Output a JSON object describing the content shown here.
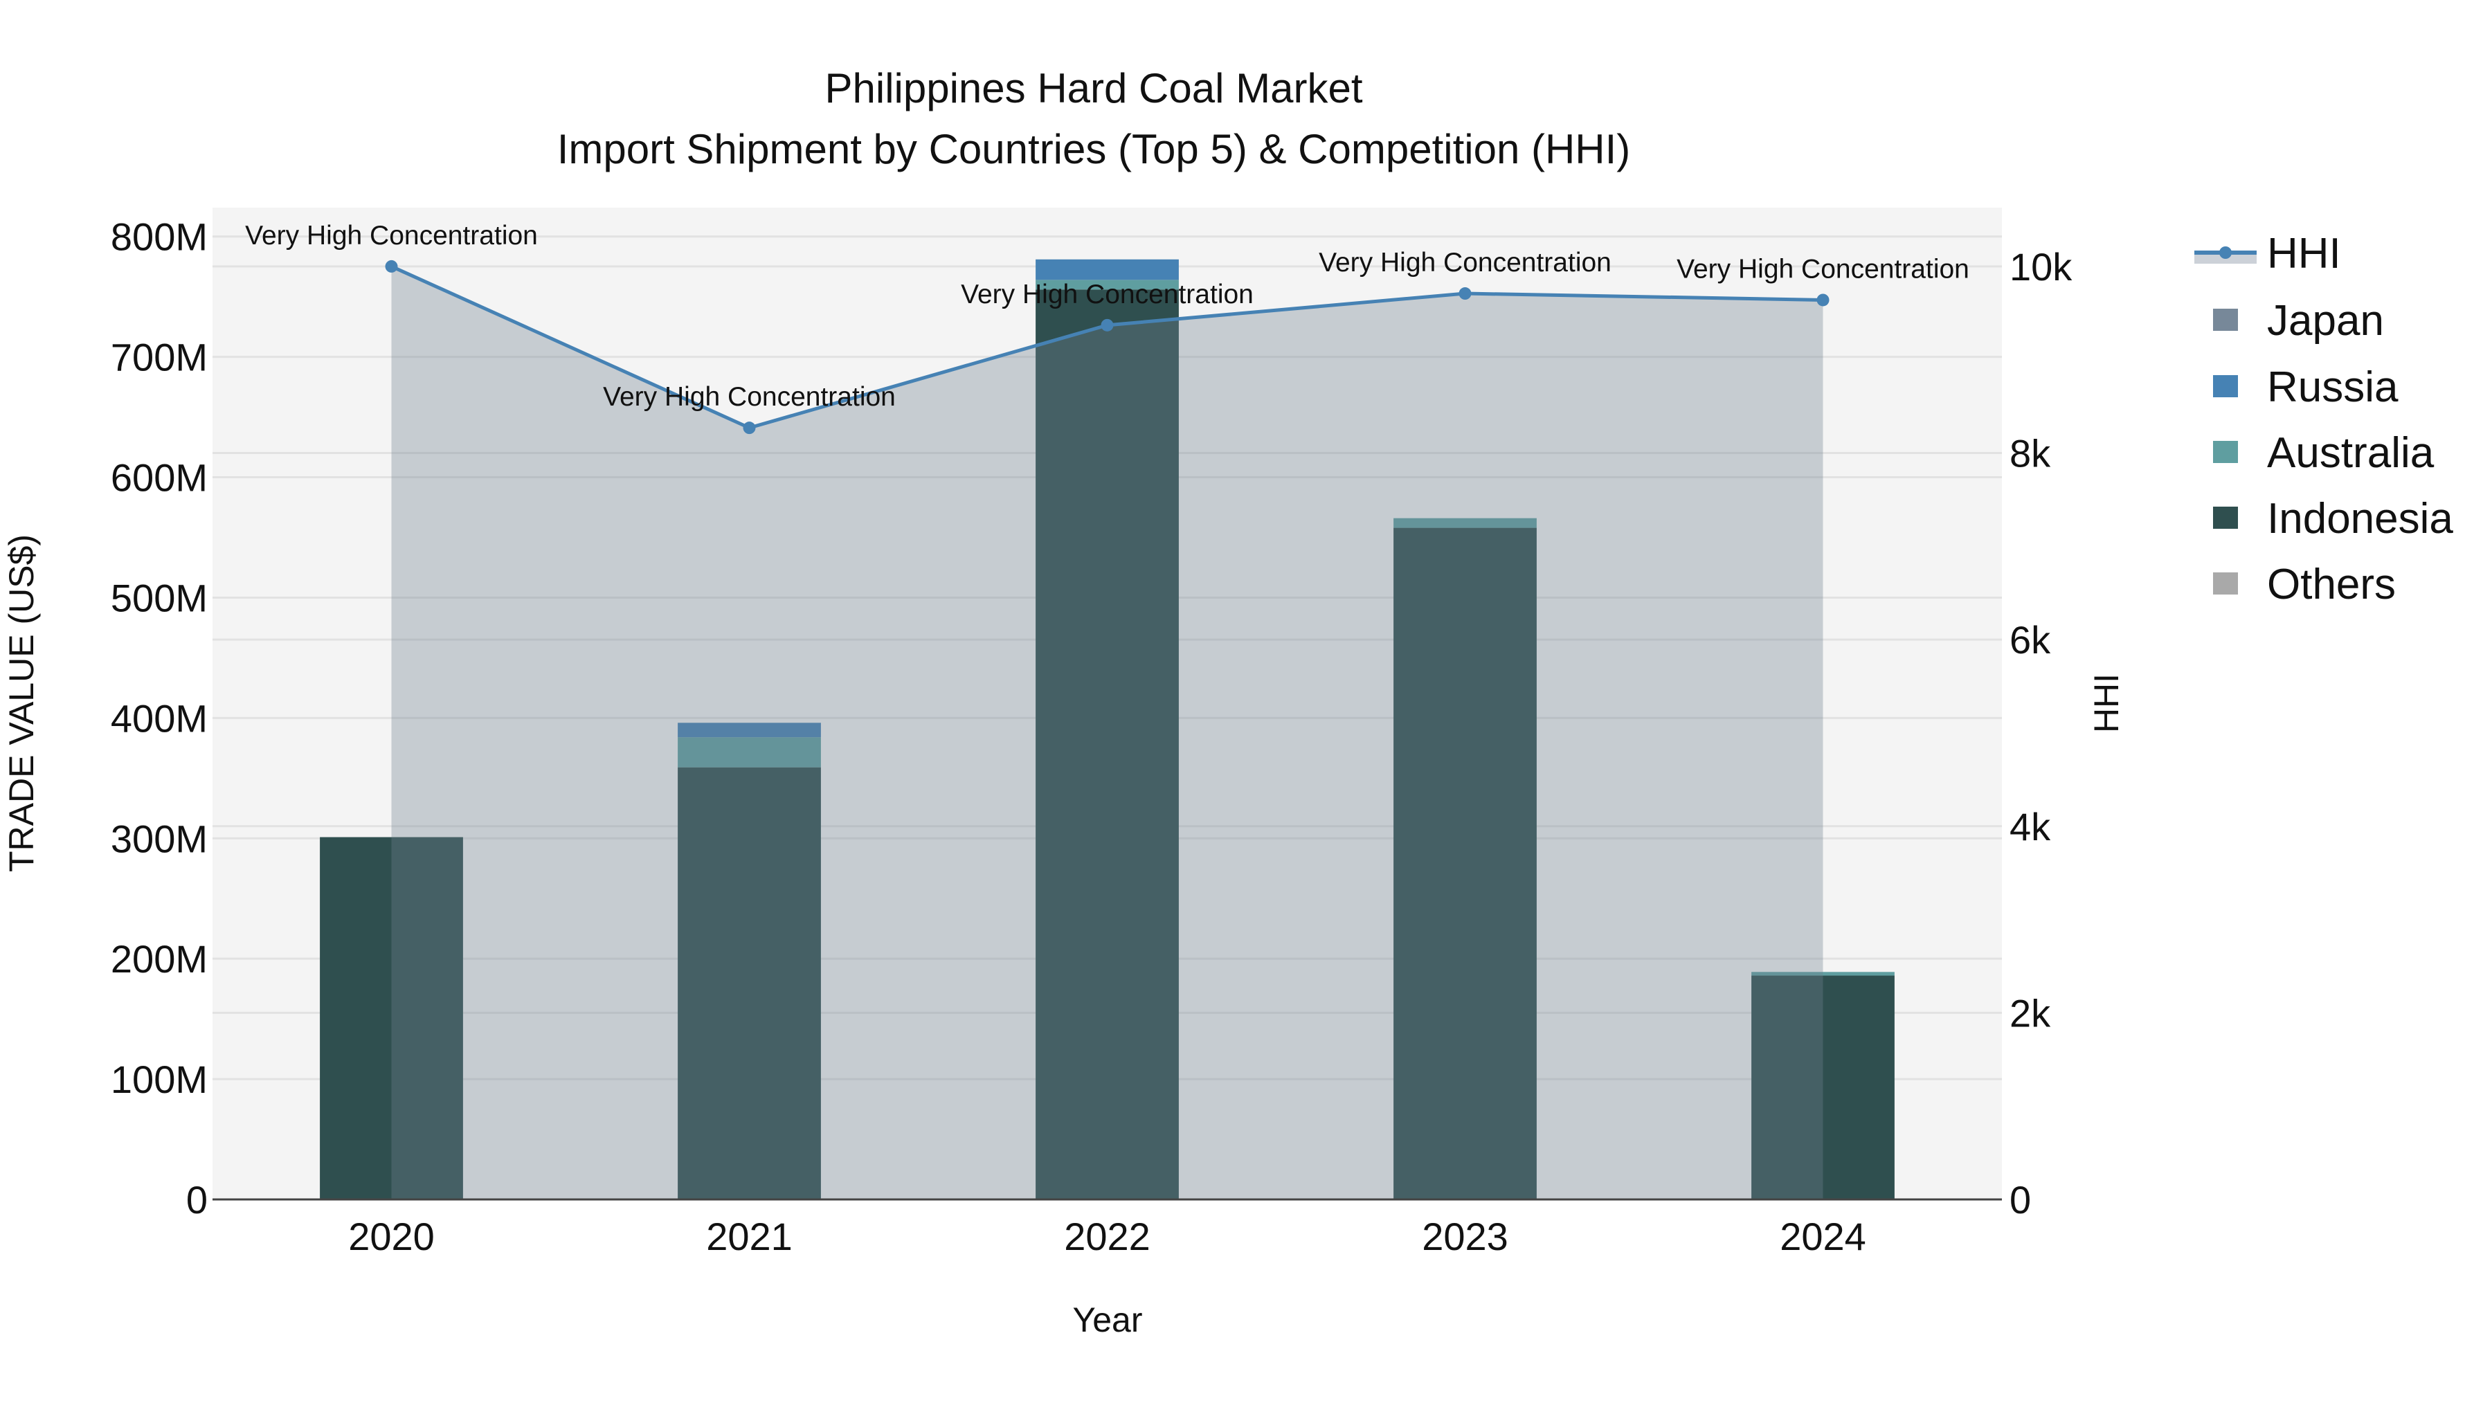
{
  "chart_data": {
    "type": "bar",
    "title": "Philippines Hard Coal Market",
    "subtitle": "Import Shipment by Countries (Top 5) & Competition (HHI)",
    "xlabel": "Year",
    "ylabel": "TRADE VALUE (US$)",
    "y2label": "HHI",
    "categories": [
      "2020",
      "2021",
      "2022",
      "2023",
      "2024"
    ],
    "barmode": "stack",
    "ylim": [
      0,
      824
    ],
    "y_unit": "M",
    "yticks": [
      0,
      100,
      200,
      300,
      400,
      500,
      600,
      700,
      800
    ],
    "ytick_labels": [
      "0",
      "100M",
      "200M",
      "300M",
      "400M",
      "500M",
      "600M",
      "700M",
      "800M"
    ],
    "y2lim": [
      0,
      10630
    ],
    "y2ticks": [
      0,
      2000,
      4000,
      6000,
      8000,
      10000
    ],
    "y2tick_labels": [
      "0",
      "2k",
      "4k",
      "6k",
      "8k",
      "10k"
    ],
    "series": [
      {
        "name": "Indonesia",
        "color": "#2f4f4f",
        "values": [
          301,
          359,
          756,
          558,
          186
        ]
      },
      {
        "name": "Australia",
        "color": "#5f9ea0",
        "values": [
          0,
          25,
          8,
          8,
          3
        ]
      },
      {
        "name": "Russia",
        "color": "#4682b4",
        "values": [
          0,
          12,
          17,
          0,
          0
        ]
      },
      {
        "name": "Japan",
        "color": "#778899",
        "values": [
          0,
          0,
          0,
          0,
          0
        ]
      },
      {
        "name": "Others",
        "color": "#a9a9a9",
        "values": [
          0,
          0,
          0,
          0,
          0
        ]
      }
    ],
    "line": {
      "name": "HHI",
      "color": "#4682b4",
      "fill": "rgba(112,128,144,0.35)",
      "axis": "y2",
      "values": [
        10000,
        8270,
        9370,
        9710,
        9640
      ],
      "annotations": [
        "Very High Concentration",
        "Very High Concentration",
        "Very High Concentration",
        "Very High Concentration",
        "Very High Concentration"
      ]
    },
    "legend": {
      "placement": "right",
      "items": [
        "HHI",
        "Japan",
        "Russia",
        "Australia",
        "Indonesia",
        "Others"
      ]
    },
    "grid": true
  }
}
